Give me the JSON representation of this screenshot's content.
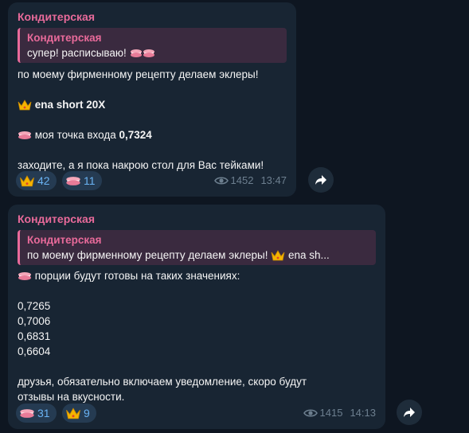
{
  "messages": [
    {
      "author": "Кондитерская",
      "quote": {
        "author": "Кондитерская",
        "text": "супер! расписываю!"
      },
      "lines": {
        "intro": "по моему фирменному рецепту  делаем эклеры!",
        "trade": "ena short 20X",
        "entry_label": "моя точка входа ",
        "entry_value": "0,7324",
        "outro": "заходите, а я пока накрою стол для Вас тейками!"
      },
      "reactions": [
        {
          "icon": "crown-icon",
          "count": "42"
        },
        {
          "icon": "macaron-icon",
          "count": "11"
        }
      ],
      "views": "1452",
      "time": "13:47"
    },
    {
      "author": "Кондитерская",
      "quote": {
        "author": "Кондитерская",
        "text_start": "по моему фирменному рецепту  делаем эклеры! ",
        "text_end": " ena sh..."
      },
      "lines": {
        "portions": "порции будут готовы на таких значениях:",
        "values": [
          "0,7265",
          "0,7006",
          "0,6831",
          "0,6604"
        ],
        "outro_1": "друзья, обязательно включаем уведомление, скоро будут",
        "outro_2": "отзывы на вкусности."
      },
      "reactions": [
        {
          "icon": "macaron-icon",
          "count": "31"
        },
        {
          "icon": "crown-icon",
          "count": "9"
        }
      ],
      "views": "1415",
      "time": "14:13"
    }
  ],
  "colors": {
    "background": "#0e1621",
    "bubble": "#182533",
    "author": "#e86a9a",
    "reaction_text": "#6ab3f3",
    "meta": "#6d7f8f"
  }
}
